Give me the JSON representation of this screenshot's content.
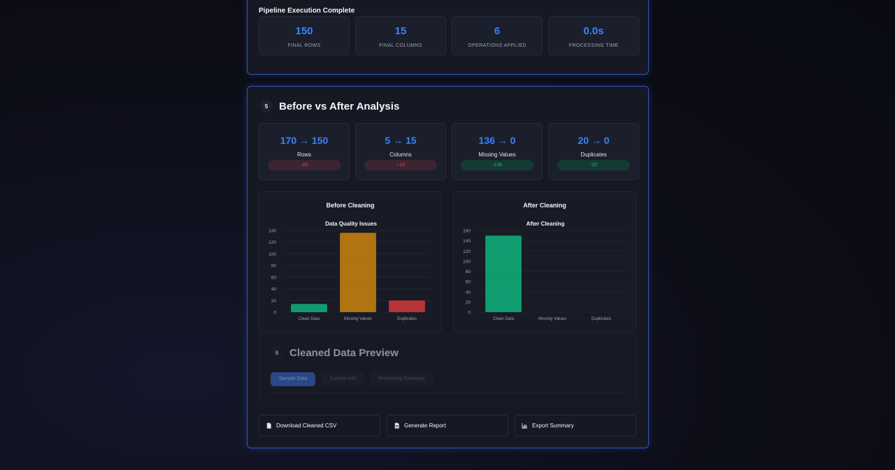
{
  "pipeline": {
    "title": "Pipeline Execution Complete",
    "stats": [
      {
        "value": "150",
        "label": "FINAL ROWS"
      },
      {
        "value": "15",
        "label": "FINAL COLUMNS"
      },
      {
        "value": "6",
        "label": "OPERATIONS APPLIED"
      },
      {
        "value": "0.0s",
        "label": "PROCESSING TIME"
      }
    ]
  },
  "analysis": {
    "step": "5",
    "title": "Before vs After Analysis",
    "comparisons": [
      {
        "value": "170 → 150",
        "label": "Rows",
        "delta": "-20",
        "status": "neg"
      },
      {
        "value": "5 → 15",
        "label": "Columns",
        "delta": "+10",
        "status": "neg"
      },
      {
        "value": "136 → 0",
        "label": "Missing Values",
        "delta": "-136",
        "status": "pos"
      },
      {
        "value": "20 → 0",
        "label": "Duplicates",
        "delta": "-20",
        "status": "pos"
      }
    ]
  },
  "chart_data": [
    {
      "type": "bar",
      "card_title": "Before Cleaning",
      "title": "Data Quality Issues",
      "categories": [
        "Clean Data",
        "Missing Values",
        "Duplicates"
      ],
      "values": [
        14,
        136,
        20
      ],
      "colors": [
        "#10b981",
        "#d4870e",
        "#dc3c3c"
      ],
      "ylim": [
        0,
        140
      ],
      "yticks": [
        0,
        20,
        40,
        60,
        80,
        100,
        120,
        140
      ],
      "grid": true
    },
    {
      "type": "bar",
      "card_title": "After Cleaning",
      "title": "After Cleaning",
      "categories": [
        "Clean Data",
        "Missing Values",
        "Duplicates"
      ],
      "values": [
        150,
        0,
        0
      ],
      "colors": [
        "#10b981",
        "#d4870e",
        "#dc3c3c"
      ],
      "ylim": [
        0,
        160
      ],
      "yticks": [
        0,
        20,
        40,
        60,
        80,
        100,
        120,
        140,
        160
      ],
      "grid": true
    }
  ],
  "preview": {
    "step": "6",
    "title": "Cleaned Data Preview",
    "tabs": [
      "Sample Data",
      "Column Info",
      "Processing Summary"
    ]
  },
  "actions": [
    {
      "label": "Download Cleaned CSV",
      "icon": "file-icon"
    },
    {
      "label": "Generate Report",
      "icon": "document-icon"
    },
    {
      "label": "Export Summary",
      "icon": "chart-icon"
    }
  ],
  "colors": {
    "accent": "#3b82f6",
    "border": "#2f56b8",
    "positive": "#10b981",
    "negative": "#ef4444"
  }
}
